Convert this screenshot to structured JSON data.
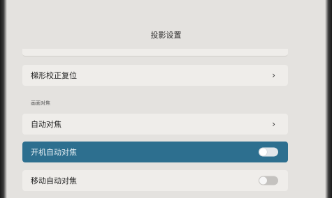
{
  "header": {
    "title": "投影设置"
  },
  "rows": {
    "keystone_reset": {
      "label": "梯形校正复位",
      "icon": "chevron-right-icon"
    },
    "section_focus": {
      "label": "画面对焦"
    },
    "auto_focus": {
      "label": "自动对焦",
      "icon": "chevron-right-icon"
    },
    "boot_auto_focus": {
      "label": "开机自动对焦",
      "toggle_on": false
    },
    "move_auto_focus": {
      "label": "移动自动对焦",
      "toggle_on": false
    }
  },
  "colors": {
    "accent": "#2d6f8f",
    "card": "#efedea",
    "background": "#e4e2df"
  }
}
